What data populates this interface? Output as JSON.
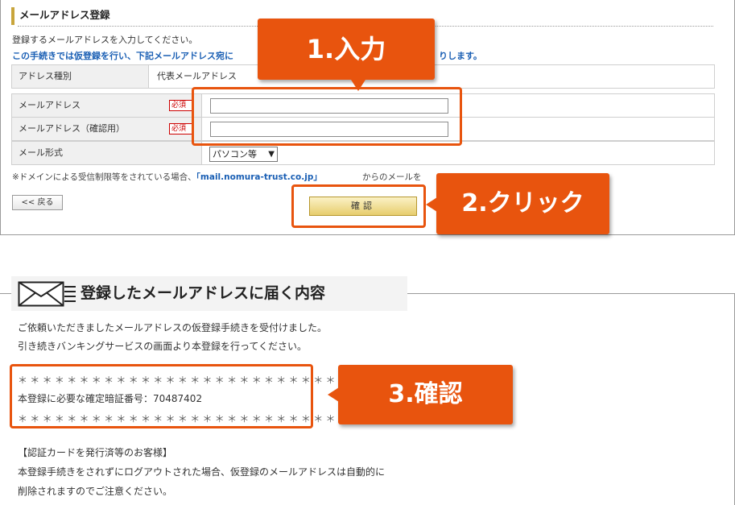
{
  "form": {
    "section_title": "メールアドレス登録",
    "intro_line1": "登録するメールアドレスを入力してください。",
    "intro_line2_start": "この手続きでは仮登録を行い、下記メールアドレス宛に",
    "intro_line2_end": "りします。",
    "rows": [
      {
        "label": "アドレス種別",
        "value": "代表メールアドレス"
      },
      {
        "label": "メールアドレス",
        "badge": "必須",
        "input_value": ""
      },
      {
        "label": "メールアドレス（確認用）",
        "badge": "必須",
        "input_value": ""
      },
      {
        "label": "メール形式",
        "select_value": "パソコン等"
      }
    ],
    "notice_start": "※ドメインによる受信制限等をされている場合、",
    "notice_link": "「mail.nomura-trust.co.jp」",
    "notice_end": "からのメールを",
    "back_label": "<< 戻る",
    "confirm_label": "確認"
  },
  "callouts": {
    "step1": "1.入力",
    "step2": "2.クリック",
    "step3": "3.確認"
  },
  "mail": {
    "header_title": "登録したメールアドレスに届く内容",
    "line1": "ご依頼いただきましたメールアドレスの仮登録手続きを受付けました。",
    "line2": "引き続きバンキングサービスの画面より本登録を行ってください。",
    "stars": "＊＊＊＊＊＊＊＊＊＊＊＊＊＊＊＊＊＊＊＊＊＊＊＊＊＊",
    "code_line": "本登録に必要な確定暗証番号：70487402",
    "section_heading": "【認証カードを発行済等のお客様】",
    "line3": "本登録手続きをされずにログアウトされた場合、仮登録のメールアドレスは自動的に",
    "line4": "削除されますのでご注意ください。"
  },
  "colors": {
    "accent": "#e8540e",
    "link": "#1a5fb4",
    "title_bar": "#c8a53c",
    "required": "#cc0000"
  },
  "icons": {
    "mail": "envelope-icon",
    "lines": "lines-icon"
  }
}
